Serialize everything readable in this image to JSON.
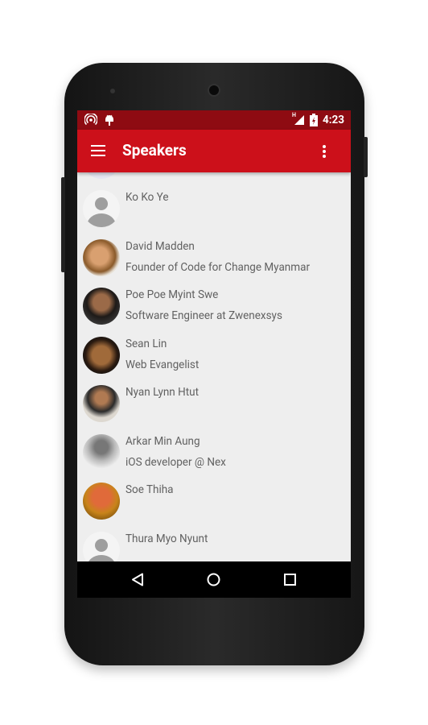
{
  "status_bar": {
    "time": "4:23",
    "network": "H",
    "icons": [
      "hotspot-icon",
      "android-debug-icon",
      "signal-icon",
      "battery-charging-icon"
    ]
  },
  "app_bar": {
    "title": "Speakers",
    "menu_icon": "hamburger-icon",
    "overflow_icon": "more-vert-icon"
  },
  "speakers": [
    {
      "name": "Ko Ko Ye",
      "title": "",
      "avatar": "placeholder"
    },
    {
      "name": "David Madden",
      "title": "Founder of Code for Change Myanmar",
      "avatar": "photo"
    },
    {
      "name": "Poe Poe Myint Swe",
      "title": "Software Engineer at Zwenexsys",
      "avatar": "photo"
    },
    {
      "name": "Sean Lin",
      "title": "Web Evangelist",
      "avatar": "photo"
    },
    {
      "name": "Nyan Lynn Htut",
      "title": "",
      "avatar": "photo"
    },
    {
      "name": "Arkar Min Aung",
      "title": "iOS developer @ Nex",
      "avatar": "photo"
    },
    {
      "name": "Soe Thiha",
      "title": "",
      "avatar": "photo"
    },
    {
      "name": "Thura Myo Nyunt",
      "title": "",
      "avatar": "placeholder"
    }
  ],
  "nav_bar": {
    "icons": [
      "back-icon",
      "home-icon",
      "recents-icon"
    ]
  },
  "colors": {
    "primary": "#cc101a",
    "status_bar": "#8e0b12",
    "background": "#eeeeee",
    "text": "#616161"
  }
}
